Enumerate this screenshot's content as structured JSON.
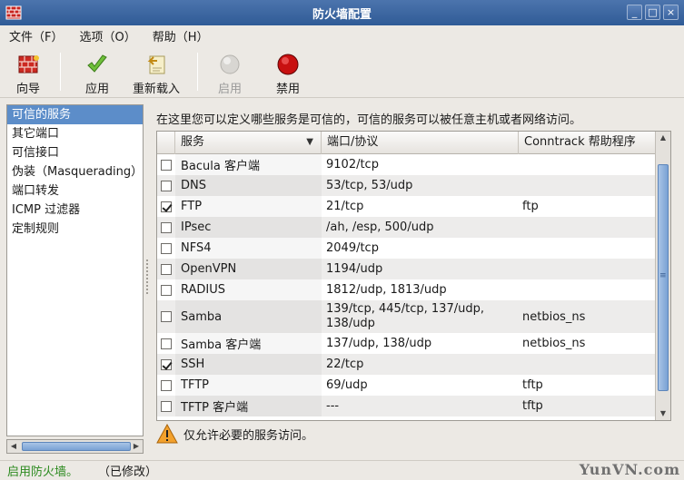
{
  "window": {
    "title": "防火墙配置",
    "controls": [
      "_",
      "□",
      "×"
    ]
  },
  "menubar": {
    "items": [
      {
        "label": "文件（F）"
      },
      {
        "label": "选项（O）"
      },
      {
        "label": "帮助（H）"
      }
    ]
  },
  "toolbar": {
    "wizard": "向导",
    "apply": "应用",
    "reload": "重新载入",
    "enable": "启用",
    "disable": "禁用"
  },
  "nav": {
    "items": [
      {
        "label": "可信的服务",
        "selected": true
      },
      {
        "label": "其它端口"
      },
      {
        "label": "可信接口"
      },
      {
        "label": "伪装（Masquerading）"
      },
      {
        "label": "端口转发"
      },
      {
        "label": "ICMP 过滤器"
      },
      {
        "label": "定制规则"
      }
    ]
  },
  "main": {
    "description": "在这里您可以定义哪些服务是可信的，可信的服务可以被任意主机或者网络访问。",
    "columns": {
      "service": "服务",
      "port": "端口/协议",
      "helper": "Conntrack 帮助程序"
    },
    "rows": [
      {
        "checked": false,
        "service": "Bacula 客户端",
        "port": "9102/tcp",
        "helper": ""
      },
      {
        "checked": false,
        "service": "DNS",
        "port": "53/tcp, 53/udp",
        "helper": ""
      },
      {
        "checked": true,
        "service": "FTP",
        "port": "21/tcp",
        "helper": "ftp"
      },
      {
        "checked": false,
        "service": "IPsec",
        "port": "/ah, /esp, 500/udp",
        "helper": ""
      },
      {
        "checked": false,
        "service": "NFS4",
        "port": "2049/tcp",
        "helper": ""
      },
      {
        "checked": false,
        "service": "OpenVPN",
        "port": "1194/udp",
        "helper": ""
      },
      {
        "checked": false,
        "service": "RADIUS",
        "port": "1812/udp, 1813/udp",
        "helper": ""
      },
      {
        "checked": false,
        "service": "Samba",
        "port": "139/tcp, 445/tcp, 137/udp, 138/udp",
        "helper": "netbios_ns",
        "tall": true
      },
      {
        "checked": false,
        "service": "Samba 客户端",
        "port": "137/udp, 138/udp",
        "helper": "netbios_ns"
      },
      {
        "checked": true,
        "service": "SSH",
        "port": "22/tcp",
        "helper": ""
      },
      {
        "checked": false,
        "service": "TFTP",
        "port": "69/udp",
        "helper": "tftp"
      },
      {
        "checked": false,
        "service": "TFTP 客户端",
        "port": "---",
        "helper": "tftp"
      }
    ],
    "note": "仅允许必要的服务访问。"
  },
  "status": {
    "enabled": "启用防火墙。",
    "modified": "（已修改）"
  },
  "watermark": "YunVN.com"
}
